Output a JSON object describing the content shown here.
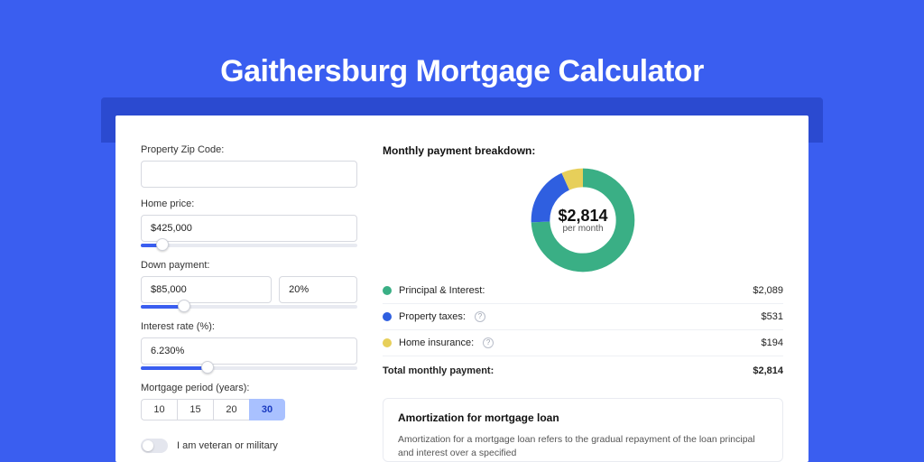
{
  "page": {
    "title": "Gaithersburg Mortgage Calculator"
  },
  "form": {
    "zip_label": "Property Zip Code:",
    "zip_value": "",
    "home_price_label": "Home price:",
    "home_price_value": "$425,000",
    "down_payment_label": "Down payment:",
    "down_payment_value": "$85,000",
    "down_payment_pct": "20%",
    "interest_label": "Interest rate (%):",
    "interest_value": "6.230%",
    "period_label": "Mortgage period (years):",
    "periods": [
      "10",
      "15",
      "20",
      "30"
    ],
    "period_selected": "30",
    "vet_label": "I am veteran or military"
  },
  "breakdown": {
    "title": "Monthly payment breakdown:",
    "center_amount": "$2,814",
    "center_sub": "per month",
    "rows": [
      {
        "label": "Principal & Interest:",
        "value": "$2,089",
        "color": "green",
        "info": false
      },
      {
        "label": "Property taxes:",
        "value": "$531",
        "color": "blue",
        "info": true
      },
      {
        "label": "Home insurance:",
        "value": "$194",
        "color": "yellow",
        "info": true
      }
    ],
    "total_label": "Total monthly payment:",
    "total_value": "$2,814"
  },
  "amort": {
    "title": "Amortization for mortgage loan",
    "text": "Amortization for a mortgage loan refers to the gradual repayment of the loan principal and interest over a specified"
  },
  "chart_data": {
    "type": "pie",
    "title": "Monthly payment breakdown",
    "series": [
      {
        "name": "Principal & Interest",
        "value": 2089,
        "color": "#3aaf85"
      },
      {
        "name": "Property taxes",
        "value": 531,
        "color": "#2f5fe0"
      },
      {
        "name": "Home insurance",
        "value": 194,
        "color": "#e7cf5a"
      }
    ],
    "total": 2814,
    "center_label": "$2,814 per month"
  }
}
